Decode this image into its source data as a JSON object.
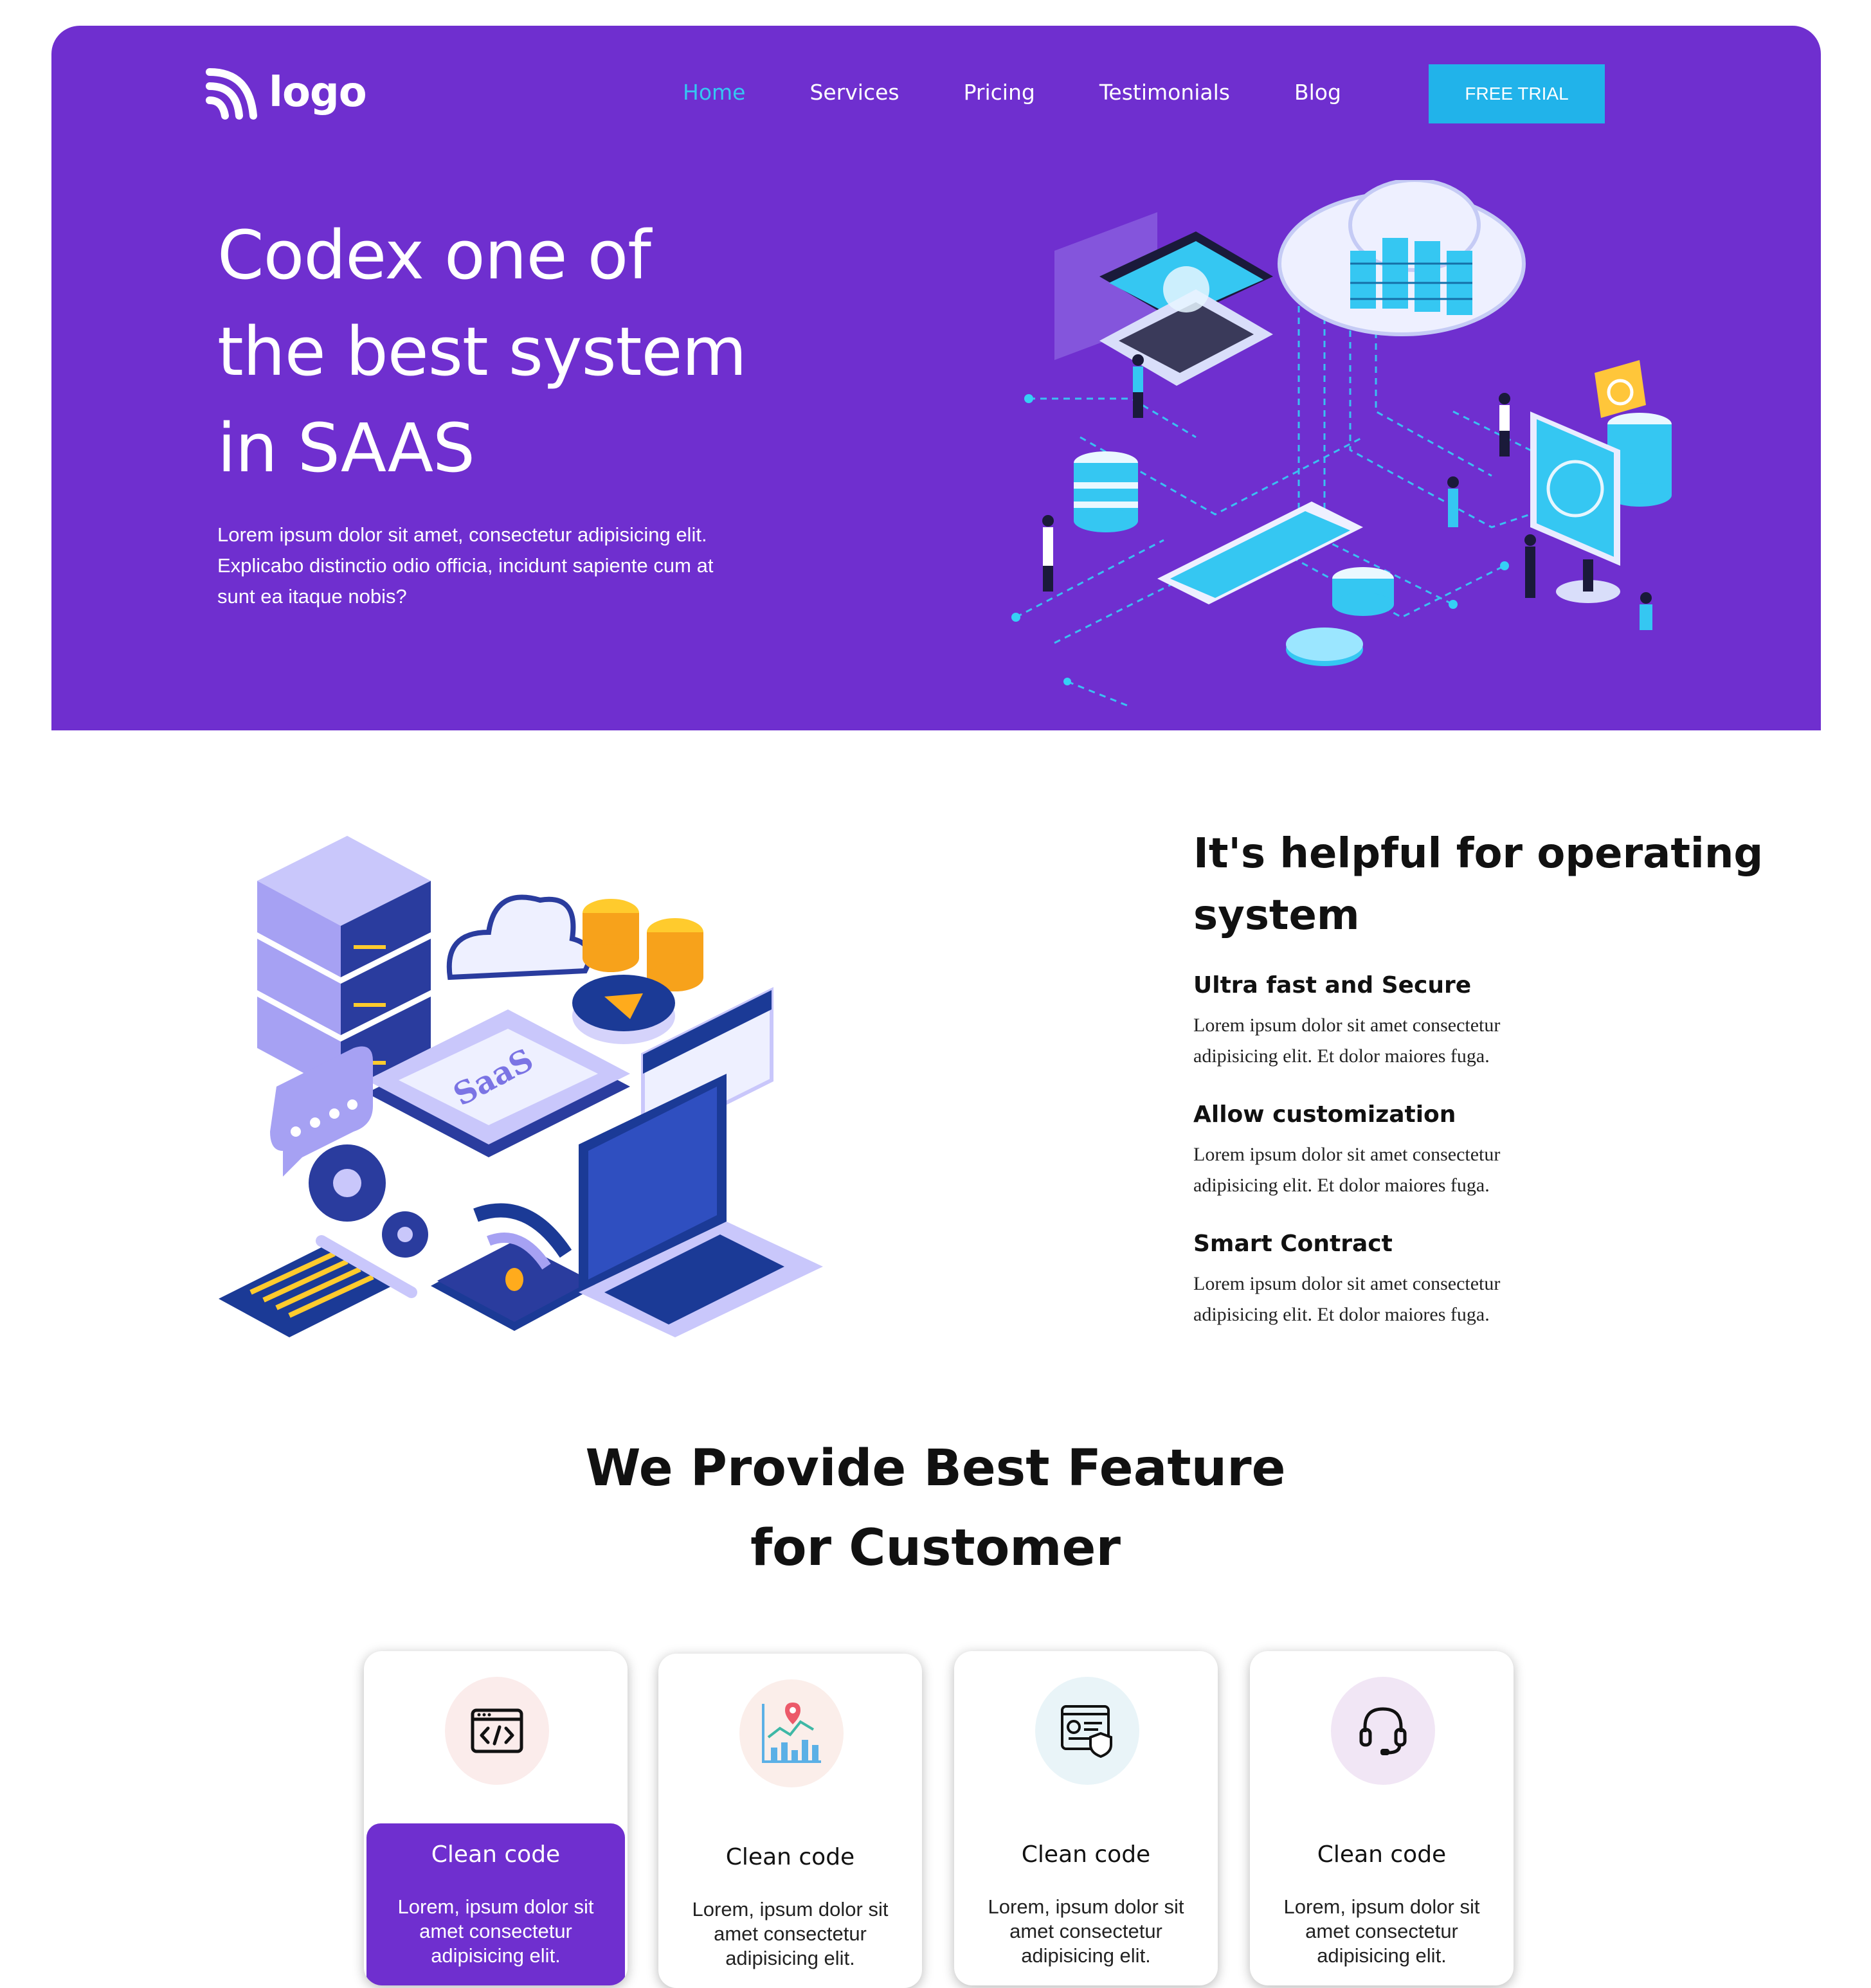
{
  "header": {
    "logo_text": "logo",
    "nav": [
      {
        "label": "Home",
        "active": true
      },
      {
        "label": "Services",
        "active": false
      },
      {
        "label": "Pricing",
        "active": false
      },
      {
        "label": "Testimonials",
        "active": false
      },
      {
        "label": "Blog",
        "active": false
      }
    ],
    "cta_label": "FREE TRIAL"
  },
  "hero": {
    "title_lines": [
      "Codex one of",
      "the best system",
      "in SAAS"
    ],
    "description": "Lorem ipsum dolor sit amet, consectetur adipisicing elit. Explicabo distinctio odio officia, incidunt sapiente cum at sunt ea itaque nobis?",
    "illustration": "isometric-cloud-network-illustration"
  },
  "os_section": {
    "title": "It's helpful for operating system",
    "illustration_label": "SaaS",
    "features": [
      {
        "title": "Ultra fast and Secure",
        "text": "Lorem ipsum dolor sit amet consectetur adipisicing elit. Et dolor maiores fuga."
      },
      {
        "title": "Allow customization",
        "text": "Lorem ipsum dolor sit amet consectetur adipisicing elit. Et dolor maiores fuga."
      },
      {
        "title": "Smart Contract",
        "text": "Lorem ipsum dolor sit amet consectetur adipisicing elit. Et dolor maiores fuga."
      }
    ]
  },
  "features_section": {
    "title_lines": [
      "We Provide Best Feature",
      "for Customer"
    ],
    "cards": [
      {
        "icon": "code-window-icon",
        "title": "Clean code",
        "text": "Lorem, ipsum dolor sit amet consectetur adipisicing elit.",
        "active": true,
        "icon_bg": "#fbeceb"
      },
      {
        "icon": "analytics-chart-icon",
        "title": "Clean code",
        "text": "Lorem, ipsum dolor sit amet consectetur adipisicing elit.",
        "active": false,
        "icon_bg": "#fbeeea"
      },
      {
        "icon": "secure-profile-icon",
        "title": "Clean code",
        "text": "Lorem, ipsum dolor sit amet consectetur adipisicing elit.",
        "active": false,
        "icon_bg": "#e9f4f8"
      },
      {
        "icon": "headset-icon",
        "title": "Clean code",
        "text": "Lorem, ipsum dolor sit amet consectetur adipisicing elit.",
        "active": false,
        "icon_bg": "#f1e6f5"
      }
    ]
  },
  "colors": {
    "brand_purple": "#6f2fcf",
    "accent_cyan": "#21b3ea",
    "active_nav": "#35c7f2"
  }
}
